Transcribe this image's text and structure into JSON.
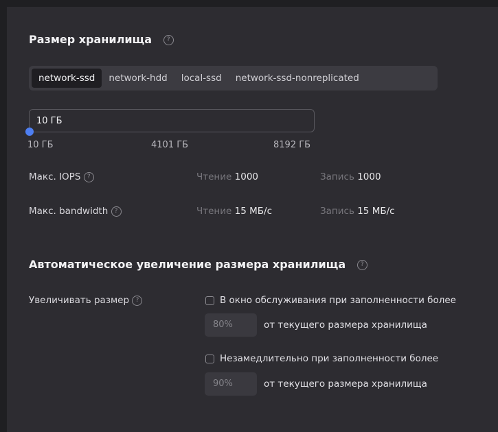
{
  "storage": {
    "title": "Размер хранилища",
    "help_glyph": "?",
    "tabs": [
      "network-ssd",
      "network-hdd",
      "local-ssd",
      "network-ssd-nonreplicated"
    ],
    "active_tab": "network-ssd",
    "size_value": "10 ГБ",
    "slider": {
      "min_label": "10 ГБ",
      "mid_label": "4101 ГБ",
      "max_label": "8192 ГБ",
      "value_fraction": 0
    }
  },
  "iops": {
    "label": "Макс. IOPS",
    "read_label": "Чтение",
    "read_value": "1000",
    "write_label": "Запись",
    "write_value": "1000"
  },
  "bandwidth": {
    "label": "Макс. bandwidth",
    "read_label": "Чтение",
    "read_value": "15 МБ/с",
    "write_label": "Запись",
    "write_value": "15 МБ/с"
  },
  "autogrow": {
    "title": "Автоматическое увеличение размера хранилища",
    "increase_label": "Увеличивать размер",
    "option1_label": "В окно обслуживания при заполненности более",
    "option1_value": "80%",
    "option1_suffix": "от текущего размера хранилища",
    "option1_checked": false,
    "option2_label": "Незамедлительно при заполненности более",
    "option2_value": "90%",
    "option2_suffix": "от текущего размера хранилища",
    "option2_checked": false
  },
  "colors": {
    "accent": "#4e7ff2",
    "panel_bg": "#2d2c31",
    "tab_bar_bg": "#3c3b41",
    "active_tab_bg": "#1f1e22"
  }
}
